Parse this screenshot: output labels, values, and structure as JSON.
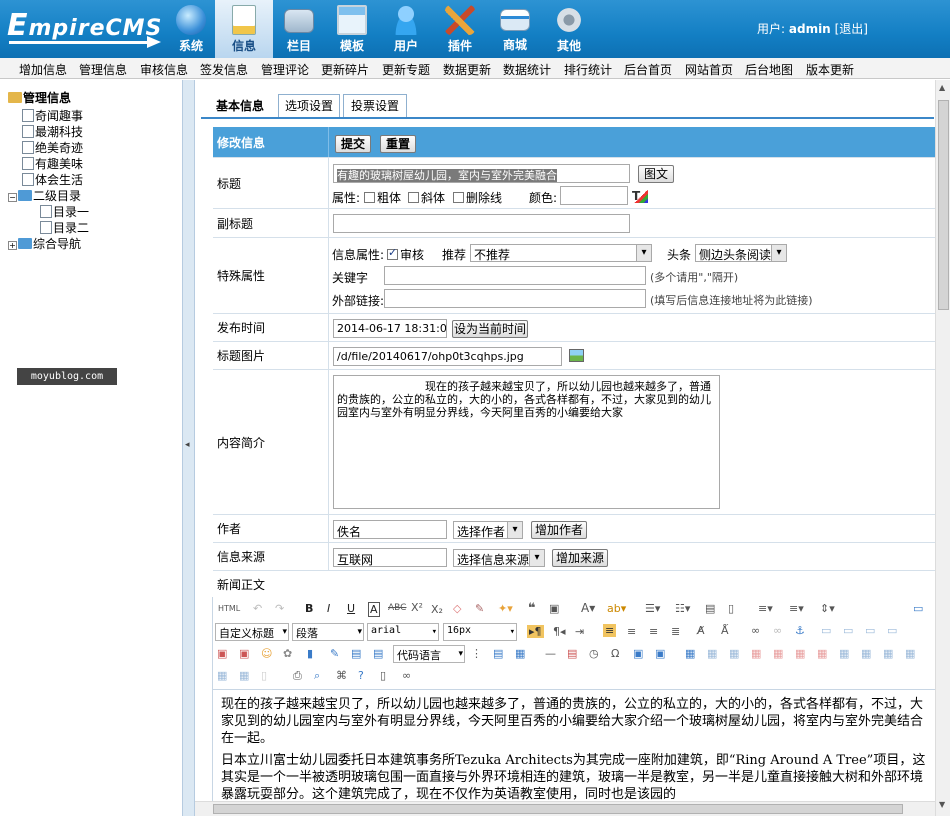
{
  "app": {
    "logo_main": "E",
    "logo_rest": "mpireCMS"
  },
  "topnav": [
    {
      "label": "系统",
      "icon": "globe-icon"
    },
    {
      "label": "信息",
      "icon": "document-icon"
    },
    {
      "label": "栏目",
      "icon": "folder-icon"
    },
    {
      "label": "模板",
      "icon": "template-icon"
    },
    {
      "label": "用户",
      "icon": "user-icon"
    },
    {
      "label": "插件",
      "icon": "tools-icon"
    },
    {
      "label": "商城",
      "icon": "shop-icon"
    },
    {
      "label": "其他",
      "icon": "gear-icon"
    }
  ],
  "user": {
    "prefix": "用户:",
    "name": "admin",
    "logout": "[退出]"
  },
  "subnav": [
    "增加信息",
    "管理信息",
    "审核信息",
    "签发信息",
    "管理评论",
    "更新碎片",
    "更新专题",
    "数据更新",
    "数据统计",
    "排行统计",
    "后台首页",
    "网站首页",
    "后台地图",
    "版本更新"
  ],
  "tree": {
    "root": "管理信息",
    "items": [
      "奇闻趣事",
      "最潮科技",
      "绝美奇迹",
      "有趣美味",
      "体会生活"
    ],
    "group": "二级目录",
    "sub": [
      "目录一",
      "目录二"
    ],
    "last": "综合导航"
  },
  "watermark": "moyublog.com",
  "tabs": [
    "基本信息",
    "选项设置",
    "投票设置"
  ],
  "form": {
    "header": "修改信息",
    "submit": "提交",
    "reset": "重置",
    "title_label": "标题",
    "title_value": "有趣的玻璃树屋幼儿园，室内与室外完美融合",
    "title_btn": "图文",
    "attr_label": "属性:",
    "bold": "粗体",
    "italic": "斜体",
    "strike": "删除线",
    "color_label": "颜色:",
    "subtitle_label": "副标题",
    "special_label": "特殊属性",
    "info_attr": "信息属性:",
    "audit": "审核",
    "recommend": "推荐",
    "recommend_value": "不推荐",
    "headline": "头条",
    "headline_value": "侧边头条阅读",
    "keyword_label": "关键字",
    "keyword_hint": "(多个请用\",\"隔开)",
    "link_label": "外部链接:",
    "link_hint": "(填写后信息连接地址将为此链接)",
    "time_label": "发布时间",
    "time_value": "2014-06-17 18:31:04",
    "time_btn": "设为当前时间",
    "pic_label": "标题图片",
    "pic_value": "/d/file/20140617/ohp0t3cqhps.jpg",
    "summary_label": "内容简介",
    "summary_value": "现在的孩子越来越宝贝了，所以幼儿园也越来越多了，普通的贵族的，公立的私立的，大的小的，各式各样都有，不过，大家见到的幼儿园室内与室外有明显分界线，今天阿里百秀的小编要给大家",
    "author_label": "作者",
    "author_value": "佚名",
    "author_select": "选择作者",
    "author_add": "增加作者",
    "source_label": "信息来源",
    "source_value": "互联网",
    "source_select": "选择信息来源",
    "source_add": "增加来源",
    "body_label": "新闻正文"
  },
  "editor": {
    "style_select": "自定义标题",
    "para_select": "段落",
    "font_select": "arial",
    "size_select": "16px",
    "code_select": "代码语言",
    "paragraphs": [
      "现在的孩子越来越宝贝了，所以幼儿园也越来越多了，普通的贵族的，公立的私立的，大的小的，各式各样都有，不过，大家见到的幼儿园室内与室外有明显分界线，今天阿里百秀的小编要给大家介绍一个玻璃树屋幼儿园，将室内与室外完美结合在一起。",
      "日本立川富士幼儿园委托日本建筑事务所Tezuka Architects为其完成一座附加建筑，即“Ring Around A Tree”项目，这其实是一个一半被透明玻璃包围一面直接与外界环境相连的建筑，玻璃一半是教室，另一半是儿童直接接触大树和外部环境暴露玩耍部分。这个建筑完成了，现在不仅作为英语教室使用，同时也是该园的"
    ]
  }
}
